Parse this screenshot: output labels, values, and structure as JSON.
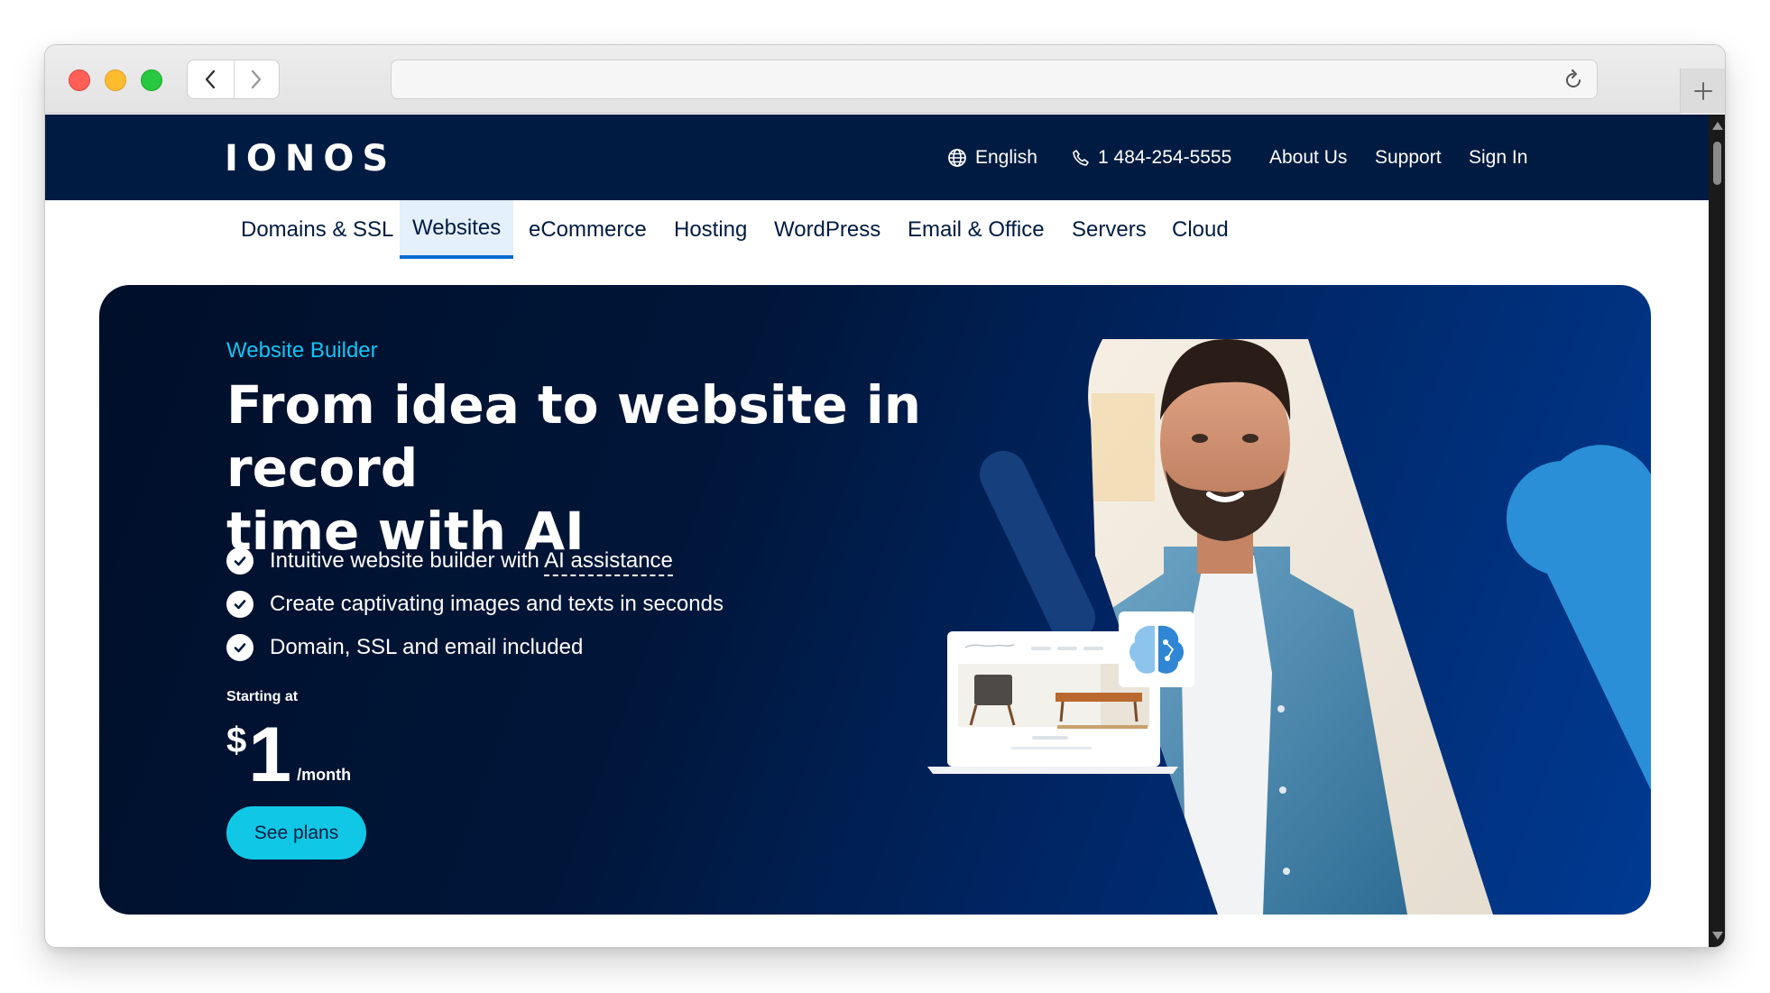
{
  "brand": {
    "logo": "IONOS"
  },
  "topnav": {
    "language": "English",
    "phone": "1 484-254-5555",
    "about": "About Us",
    "support": "Support",
    "signin": "Sign In"
  },
  "mainnav": {
    "items": [
      "Domains & SSL",
      "Websites",
      "eCommerce",
      "Hosting",
      "WordPress",
      "Email & Office",
      "Servers",
      "Cloud"
    ],
    "active": "Websites"
  },
  "hero": {
    "eyebrow": "Website Builder",
    "headline_line1": "From idea to website in record",
    "headline_line2": "time with AI",
    "features": [
      {
        "text_before": "Intuitive website builder with ",
        "link_text": "AI assistance"
      },
      {
        "text": "Create captivating images and texts in seconds"
      },
      {
        "text": "Domain, SSL and email included"
      }
    ],
    "starting_label": "Starting at",
    "price_currency": "$",
    "price_amount": "1",
    "price_period": "/month",
    "cta_label": "See plans"
  },
  "colors": {
    "topbar": "#001b41",
    "accent_cyan": "#11c7e6",
    "eyebrow": "#13c3f2",
    "active_tab_underline": "#0b6bd3",
    "hero_dark": "#000f2a",
    "hero_blue": "#003a92"
  },
  "icons": [
    "back-arrow-icon",
    "forward-arrow-icon",
    "reload-icon",
    "new-tab-plus-icon",
    "globe-icon",
    "phone-icon",
    "check-circle-icon",
    "ai-brain-icon"
  ]
}
